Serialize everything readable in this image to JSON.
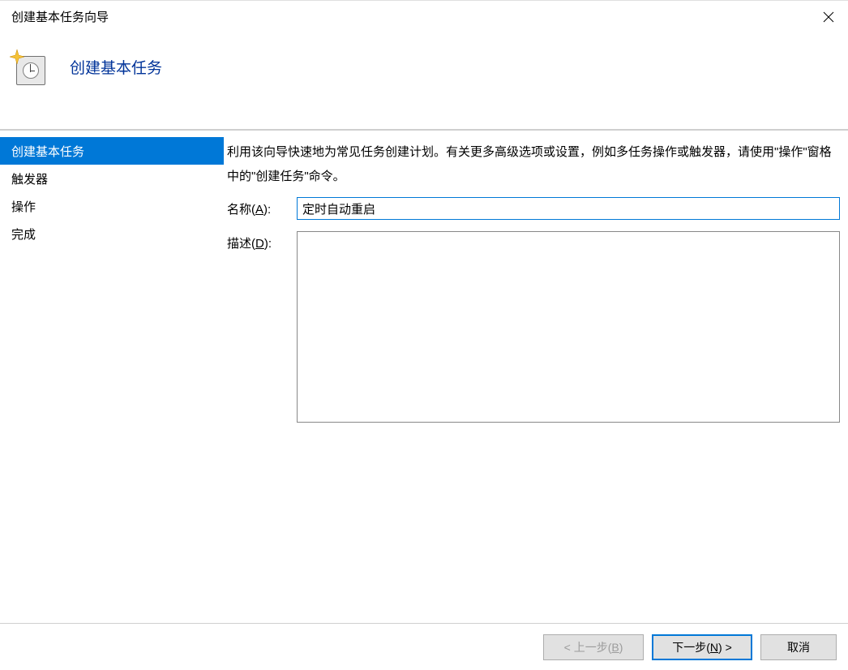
{
  "window": {
    "title": "创建基本任务向导"
  },
  "header": {
    "title": "创建基本任务"
  },
  "sidebar": {
    "steps": [
      {
        "label": "创建基本任务",
        "selected": true
      },
      {
        "label": "触发器",
        "selected": false
      },
      {
        "label": "操作",
        "selected": false
      },
      {
        "label": "完成",
        "selected": false
      }
    ]
  },
  "main": {
    "intro": "利用该向导快速地为常见任务创建计划。有关更多高级选项或设置，例如多任务操作或触发器，请使用\"操作\"窗格中的\"创建任务\"命令。",
    "name_label_prefix": "名称(",
    "name_label_key": "A",
    "name_label_suffix": "):",
    "name_value": "定时自动重启",
    "desc_label_prefix": "描述(",
    "desc_label_key": "D",
    "desc_label_suffix": "):",
    "desc_value": ""
  },
  "footer": {
    "back_prefix": "< 上一步(",
    "back_key": "B",
    "back_suffix": ")",
    "next_prefix": "下一步(",
    "next_key": "N",
    "next_suffix": ") >",
    "cancel": "取消"
  }
}
